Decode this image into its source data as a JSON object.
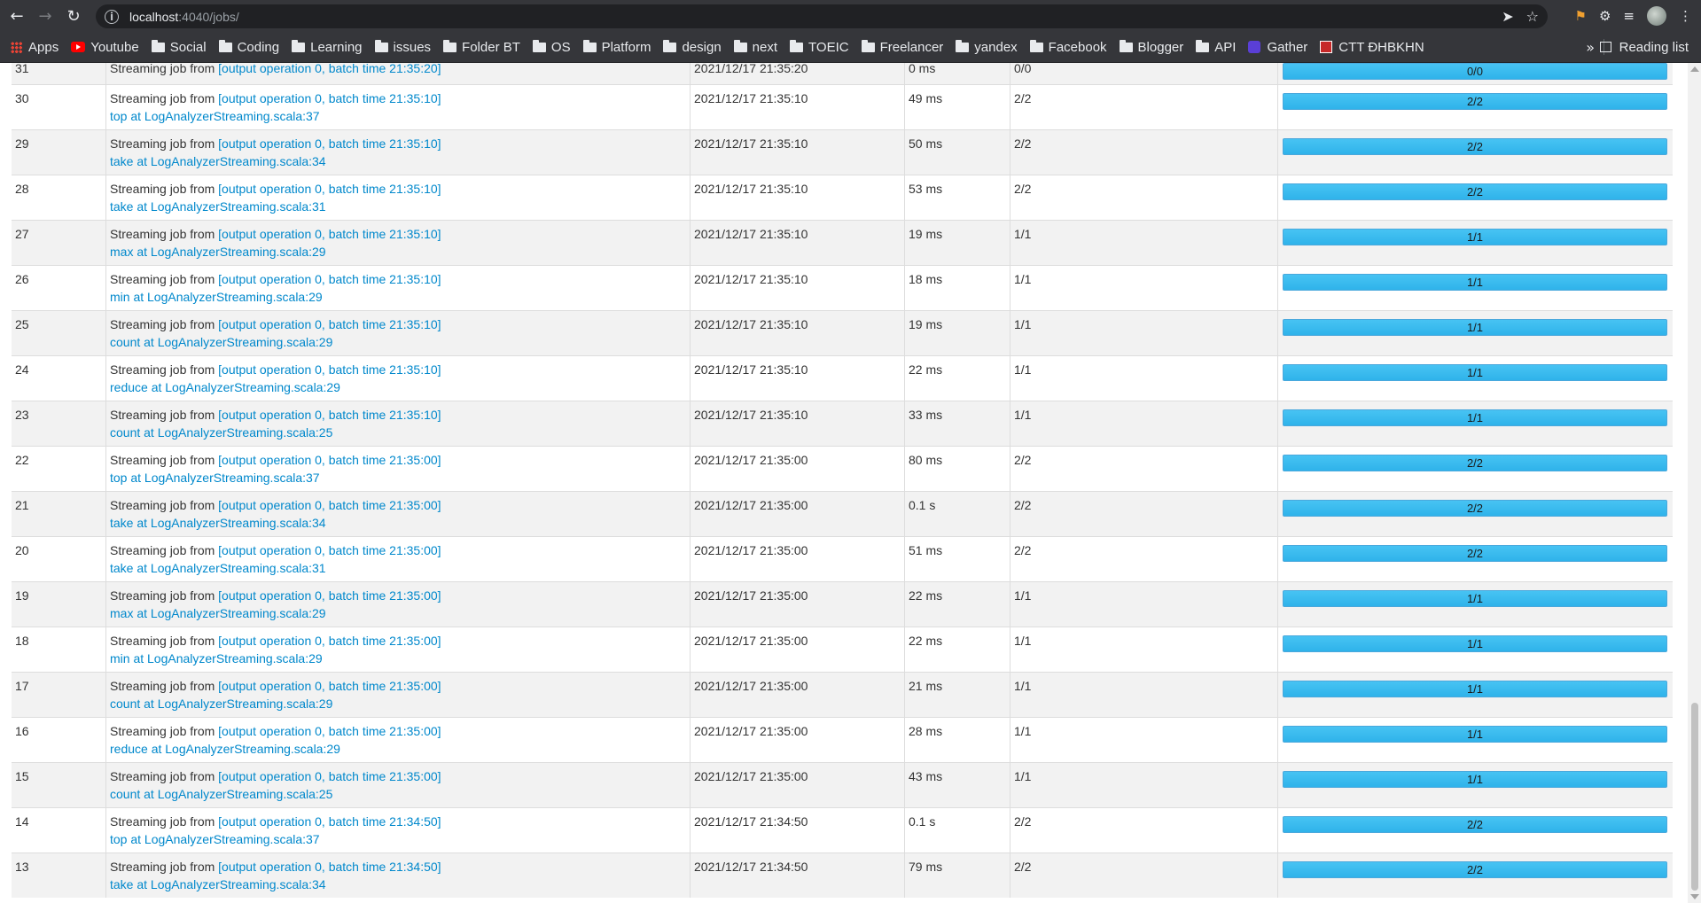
{
  "browser": {
    "url_host": "localhost",
    "url_path": ":4040/jobs/",
    "bookmarks": [
      {
        "label": "Apps",
        "icon": "apps-grid-icon"
      },
      {
        "label": "Youtube",
        "icon": "youtube-icon"
      },
      {
        "label": "Social",
        "icon": "folder-icon"
      },
      {
        "label": "Coding",
        "icon": "folder-icon"
      },
      {
        "label": "Learning",
        "icon": "folder-icon"
      },
      {
        "label": "issues",
        "icon": "folder-icon"
      },
      {
        "label": "Folder BT",
        "icon": "folder-icon"
      },
      {
        "label": "OS",
        "icon": "folder-icon"
      },
      {
        "label": "Platform",
        "icon": "folder-icon"
      },
      {
        "label": "design",
        "icon": "folder-icon"
      },
      {
        "label": "next",
        "icon": "folder-icon"
      },
      {
        "label": "TOEIC",
        "icon": "folder-icon"
      },
      {
        "label": "Freelancer",
        "icon": "folder-icon"
      },
      {
        "label": "yandex",
        "icon": "folder-icon"
      },
      {
        "label": "Facebook",
        "icon": "folder-icon"
      },
      {
        "label": "Blogger",
        "icon": "folder-icon"
      },
      {
        "label": "API",
        "icon": "folder-icon"
      },
      {
        "label": "Gather",
        "icon": "gather-icon"
      },
      {
        "label": "CTT ĐHBKHN",
        "icon": "ctt-icon"
      }
    ],
    "more_label": "»",
    "reading_list": "Reading list"
  },
  "jobs": {
    "prefix": "Streaming job from ",
    "rows": [
      {
        "id": "31",
        "link": "[output operation 0, batch time 21:35:20]",
        "op": "",
        "submitted": "2021/12/17 21:35:20",
        "duration": "0 ms",
        "stages": "0/0",
        "tasks": "0/0",
        "progress": 0
      },
      {
        "id": "30",
        "link": "[output operation 0, batch time 21:35:10]",
        "op": "top at LogAnalyzerStreaming.scala:37",
        "submitted": "2021/12/17 21:35:10",
        "duration": "49 ms",
        "stages": "2/2",
        "tasks": "2/2",
        "progress": 1
      },
      {
        "id": "29",
        "link": "[output operation 0, batch time 21:35:10]",
        "op": "take at LogAnalyzerStreaming.scala:34",
        "submitted": "2021/12/17 21:35:10",
        "duration": "50 ms",
        "stages": "2/2",
        "tasks": "2/2",
        "progress": 1
      },
      {
        "id": "28",
        "link": "[output operation 0, batch time 21:35:10]",
        "op": "take at LogAnalyzerStreaming.scala:31",
        "submitted": "2021/12/17 21:35:10",
        "duration": "53 ms",
        "stages": "2/2",
        "tasks": "2/2",
        "progress": 1
      },
      {
        "id": "27",
        "link": "[output operation 0, batch time 21:35:10]",
        "op": "max at LogAnalyzerStreaming.scala:29",
        "submitted": "2021/12/17 21:35:10",
        "duration": "19 ms",
        "stages": "1/1",
        "tasks": "1/1",
        "progress": 1
      },
      {
        "id": "26",
        "link": "[output operation 0, batch time 21:35:10]",
        "op": "min at LogAnalyzerStreaming.scala:29",
        "submitted": "2021/12/17 21:35:10",
        "duration": "18 ms",
        "stages": "1/1",
        "tasks": "1/1",
        "progress": 1
      },
      {
        "id": "25",
        "link": "[output operation 0, batch time 21:35:10]",
        "op": "count at LogAnalyzerStreaming.scala:29",
        "submitted": "2021/12/17 21:35:10",
        "duration": "19 ms",
        "stages": "1/1",
        "tasks": "1/1",
        "progress": 1
      },
      {
        "id": "24",
        "link": "[output operation 0, batch time 21:35:10]",
        "op": "reduce at LogAnalyzerStreaming.scala:29",
        "submitted": "2021/12/17 21:35:10",
        "duration": "22 ms",
        "stages": "1/1",
        "tasks": "1/1",
        "progress": 1
      },
      {
        "id": "23",
        "link": "[output operation 0, batch time 21:35:10]",
        "op": "count at LogAnalyzerStreaming.scala:25",
        "submitted": "2021/12/17 21:35:10",
        "duration": "33 ms",
        "stages": "1/1",
        "tasks": "1/1",
        "progress": 1
      },
      {
        "id": "22",
        "link": "[output operation 0, batch time 21:35:00]",
        "op": "top at LogAnalyzerStreaming.scala:37",
        "submitted": "2021/12/17 21:35:00",
        "duration": "80 ms",
        "stages": "2/2",
        "tasks": "2/2",
        "progress": 1
      },
      {
        "id": "21",
        "link": "[output operation 0, batch time 21:35:00]",
        "op": "take at LogAnalyzerStreaming.scala:34",
        "submitted": "2021/12/17 21:35:00",
        "duration": "0.1 s",
        "stages": "2/2",
        "tasks": "2/2",
        "progress": 1
      },
      {
        "id": "20",
        "link": "[output operation 0, batch time 21:35:00]",
        "op": "take at LogAnalyzerStreaming.scala:31",
        "submitted": "2021/12/17 21:35:00",
        "duration": "51 ms",
        "stages": "2/2",
        "tasks": "2/2",
        "progress": 1
      },
      {
        "id": "19",
        "link": "[output operation 0, batch time 21:35:00]",
        "op": "max at LogAnalyzerStreaming.scala:29",
        "submitted": "2021/12/17 21:35:00",
        "duration": "22 ms",
        "stages": "1/1",
        "tasks": "1/1",
        "progress": 1
      },
      {
        "id": "18",
        "link": "[output operation 0, batch time 21:35:00]",
        "op": "min at LogAnalyzerStreaming.scala:29",
        "submitted": "2021/12/17 21:35:00",
        "duration": "22 ms",
        "stages": "1/1",
        "tasks": "1/1",
        "progress": 1
      },
      {
        "id": "17",
        "link": "[output operation 0, batch time 21:35:00]",
        "op": "count at LogAnalyzerStreaming.scala:29",
        "submitted": "2021/12/17 21:35:00",
        "duration": "21 ms",
        "stages": "1/1",
        "tasks": "1/1",
        "progress": 1
      },
      {
        "id": "16",
        "link": "[output operation 0, batch time 21:35:00]",
        "op": "reduce at LogAnalyzerStreaming.scala:29",
        "submitted": "2021/12/17 21:35:00",
        "duration": "28 ms",
        "stages": "1/1",
        "tasks": "1/1",
        "progress": 1
      },
      {
        "id": "15",
        "link": "[output operation 0, batch time 21:35:00]",
        "op": "count at LogAnalyzerStreaming.scala:25",
        "submitted": "2021/12/17 21:35:00",
        "duration": "43 ms",
        "stages": "1/1",
        "tasks": "1/1",
        "progress": 1
      },
      {
        "id": "14",
        "link": "[output operation 0, batch time 21:34:50]",
        "op": "top at LogAnalyzerStreaming.scala:37",
        "submitted": "2021/12/17 21:34:50",
        "duration": "0.1 s",
        "stages": "2/2",
        "tasks": "2/2",
        "progress": 1
      },
      {
        "id": "13",
        "link": "[output operation 0, batch time 21:34:50]",
        "op": "take at LogAnalyzerStreaming.scala:34",
        "submitted": "2021/12/17 21:34:50",
        "duration": "79 ms",
        "stages": "2/2",
        "tasks": "2/2",
        "progress": 1
      }
    ]
  }
}
